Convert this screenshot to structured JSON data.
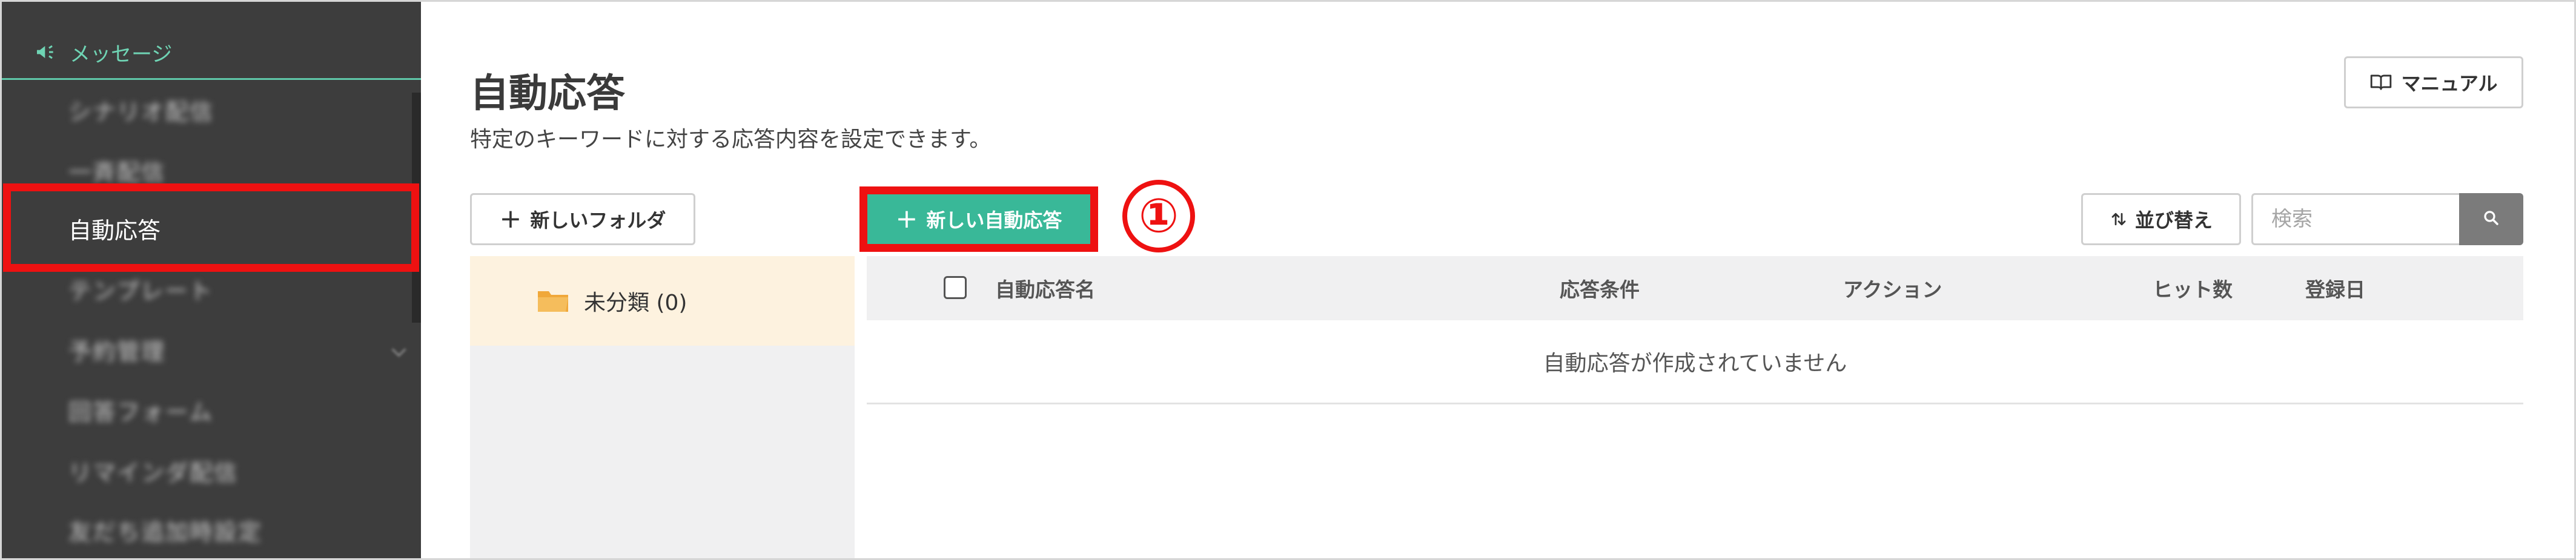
{
  "sidebar": {
    "section_title": "メッセージ",
    "items": [
      {
        "label": "シナリオ配信"
      },
      {
        "label": "一斉配信"
      },
      {
        "label": "自動応答"
      },
      {
        "label": "テンプレート"
      },
      {
        "label": "予約管理"
      },
      {
        "label": "回答フォーム"
      },
      {
        "label": "リマインダ配信"
      },
      {
        "label": "友だち追加時設定"
      }
    ]
  },
  "header": {
    "title": "自動応答",
    "description": "特定のキーワードに対する応答内容を設定できます。",
    "manual_label": "マニュアル"
  },
  "toolbar": {
    "new_folder_label": "新しいフォルダ",
    "new_auto_response_label": "新しい自動応答",
    "step_marker": "①",
    "sort_label": "並び替え",
    "search_placeholder": "検索"
  },
  "folders": [
    {
      "label": "未分類 (0)"
    }
  ],
  "table": {
    "columns": [
      "自動応答名",
      "応答条件",
      "アクション",
      "ヒット数",
      "登録日"
    ],
    "empty_message": "自動応答が作成されていません"
  },
  "colors": {
    "accent": "#39b898",
    "highlight": "#ee1111",
    "sidebar_bg": "#3d3d3d",
    "folder_icon": "#f0a83a"
  }
}
